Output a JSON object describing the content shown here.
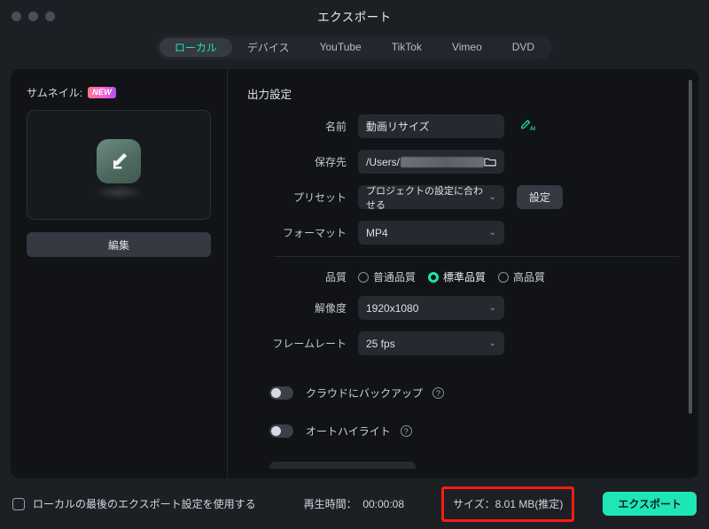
{
  "window": {
    "title": "エクスポート",
    "traffic_lights": [
      "close",
      "minimize",
      "maximize"
    ]
  },
  "tabs": {
    "active": "ローカル",
    "items": [
      {
        "label": "ローカル",
        "active": true
      },
      {
        "label": "デバイス",
        "active": false
      },
      {
        "label": "YouTube",
        "active": false
      },
      {
        "label": "TikTok",
        "active": false
      },
      {
        "label": "Vimeo",
        "active": false
      },
      {
        "label": "DVD",
        "active": false
      }
    ]
  },
  "thumbnail": {
    "label": "サムネイル:",
    "badge": "NEW",
    "edit_button": "編集",
    "icon": "pencil-icon"
  },
  "output": {
    "section_title": "出力設定",
    "name": {
      "label": "名前",
      "value": "動画リサイズ",
      "ai_icon": "ai-pen-icon"
    },
    "save_to": {
      "label": "保存先",
      "value": "/Users/",
      "redacted": true,
      "folder_icon": "folder-icon"
    },
    "preset": {
      "label": "プリセット",
      "value": "プロジェクトの設定に合わせる",
      "button": "設定"
    },
    "format": {
      "label": "フォーマット",
      "value": "MP4"
    },
    "quality": {
      "label": "品質",
      "options": [
        {
          "label": "普通品質",
          "selected": false
        },
        {
          "label": "標準品質",
          "selected": true
        },
        {
          "label": "高品質",
          "selected": false
        }
      ]
    },
    "resolution": {
      "label": "解像度",
      "value": "1920x1080"
    },
    "framerate": {
      "label": "フレームレート",
      "value": "25 fps"
    },
    "cloud_backup": {
      "label": "クラウドにバックアップ",
      "enabled": false,
      "help": "?"
    },
    "auto_highlight": {
      "label": "オートハイライト",
      "enabled": false,
      "help": "?"
    }
  },
  "footer": {
    "use_last_settings": {
      "label": "ローカルの最後のエクスポート設定を使用する",
      "checked": false
    },
    "duration_label": "再生時間：",
    "duration_value": "00:00:08",
    "size_text": "サイズ：8.01 MB(推定)",
    "export_button": "エクスポート"
  },
  "colors": {
    "accent": "#1fe6b6",
    "tab_active_text": "#24e0b4",
    "highlight_box": "#f81c10",
    "panel_bg": "#111316",
    "window_bg": "#1c1f24"
  }
}
